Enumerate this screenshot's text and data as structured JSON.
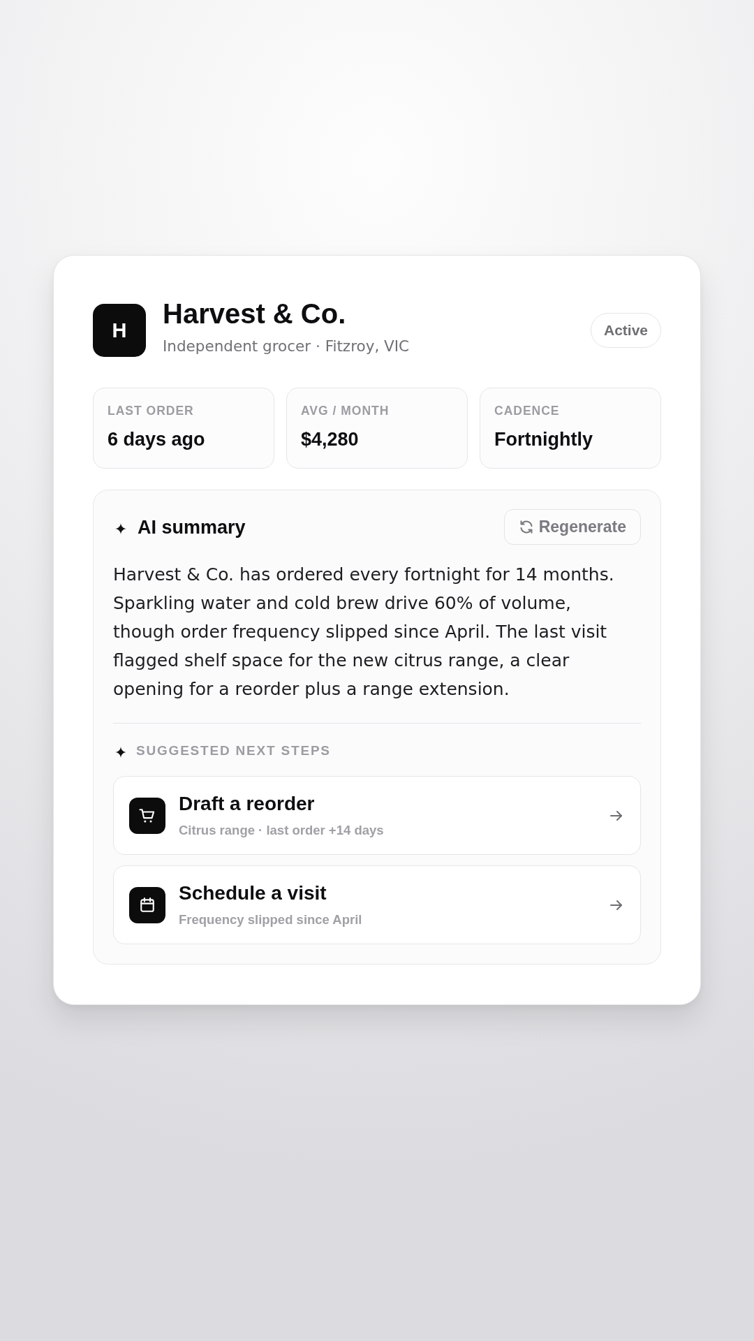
{
  "account": {
    "logo_letter": "H",
    "name": "Harvest & Co.",
    "subtitle": "Independent grocer · Fitzroy, VIC",
    "status": "Active"
  },
  "stats": [
    {
      "label": "LAST ORDER",
      "value": "6 days ago"
    },
    {
      "label": "AVG / MONTH",
      "value": "$4,280"
    },
    {
      "label": "CADENCE",
      "value": "Fortnightly"
    }
  ],
  "ai_summary": {
    "title": "AI summary",
    "regenerate_button": "Regenerate",
    "text": "Harvest & Co. has ordered every fortnight for 14 months. Sparkling water and cold brew drive 60% of volume, though order frequency slipped since April. The last visit flagged shelf space for the new citrus range, a clear opening for a reorder plus a range extension.",
    "next_steps_heading": "SUGGESTED NEXT STEPS",
    "next_steps": [
      {
        "kind": "cart",
        "title": "Draft a reorder",
        "detail": "Citrus range · last order +14 days"
      },
      {
        "kind": "calendar",
        "title": "Schedule a visit",
        "detail": "Frequency slipped since April"
      }
    ]
  }
}
